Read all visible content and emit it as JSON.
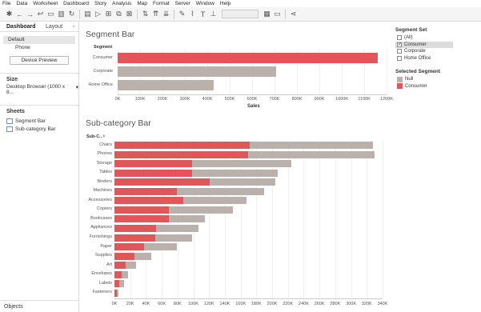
{
  "menu": [
    "File",
    "Data",
    "Worksheet",
    "Dashboard",
    "Story",
    "Analysis",
    "Map",
    "Format",
    "Server",
    "Window",
    "Help"
  ],
  "left_panel": {
    "tabs": [
      "Dashboard",
      "Layout"
    ],
    "devices": [
      "Default",
      "Phone"
    ],
    "device_preview_label": "Device Preview",
    "size_title": "Size",
    "size_value": "Desktop Browser (1000 x 8...",
    "sheets_title": "Sheets",
    "sheets": [
      "Segment Bar",
      "Sub-category Bar"
    ],
    "objects_title": "Objects"
  },
  "colors": {
    "highlight": "#e15759",
    "muted": "#bab0ac",
    "grid": "#efefef"
  },
  "segment_set_legend": {
    "title": "Segment Set",
    "items": [
      {
        "label": "(All)",
        "checked": false
      },
      {
        "label": "Consumer",
        "checked": true
      },
      {
        "label": "Corporate",
        "checked": false
      },
      {
        "label": "Home Office",
        "checked": false
      }
    ]
  },
  "selected_segment_legend": {
    "title": "Selected Segment",
    "items": [
      {
        "label": "Null",
        "color": "#bab0ac"
      },
      {
        "label": "Consumer",
        "color": "#e15759"
      }
    ]
  },
  "chart_data": [
    {
      "type": "bar",
      "orientation": "horizontal",
      "title": "Segment Bar",
      "column_header": "Segment",
      "xlabel": "Sales",
      "xlim": [
        0,
        1200000
      ],
      "ticks": [
        "0K",
        "100K",
        "200K",
        "300K",
        "400K",
        "500K",
        "600K",
        "700K",
        "800K",
        "900K",
        "1000K",
        "1100K",
        "1200K"
      ],
      "categories": [
        "Consumer",
        "Corporate",
        "Home Office"
      ],
      "values": [
        1161401,
        706146,
        429653
      ],
      "highlighted": [
        true,
        false,
        false
      ]
    },
    {
      "type": "bar",
      "orientation": "horizontal",
      "stacked": true,
      "title": "Sub-category Bar",
      "column_header": "Sub-C..",
      "xlim": [
        0,
        340000
      ],
      "ticks": [
        "0K",
        "20K",
        "40K",
        "60K",
        "80K",
        "100K",
        "120K",
        "140K",
        "160K",
        "180K",
        "200K",
        "220K",
        "240K",
        "260K",
        "280K",
        "300K",
        "320K",
        "340K"
      ],
      "categories": [
        "Chairs",
        "Phones",
        "Storage",
        "Tables",
        "Binders",
        "Machines",
        "Accessories",
        "Copiers",
        "Bookcases",
        "Appliances",
        "Furnishings",
        "Paper",
        "Supplies",
        "Art",
        "Envelopes",
        "Labels",
        "Fasteners"
      ],
      "series": [
        {
          "name": "Consumer",
          "values": [
            172000,
            169000,
            98000,
            98000,
            121000,
            79000,
            87000,
            69000,
            69000,
            53000,
            52000,
            38000,
            25000,
            14000,
            9000,
            6000,
            3000
          ]
        },
        {
          "name": "Null",
          "values": [
            156000,
            161000,
            126000,
            109000,
            83000,
            111000,
            80000,
            81000,
            46000,
            54000,
            46000,
            41000,
            22000,
            13000,
            8000,
            6000,
            2000
          ]
        }
      ]
    }
  ]
}
